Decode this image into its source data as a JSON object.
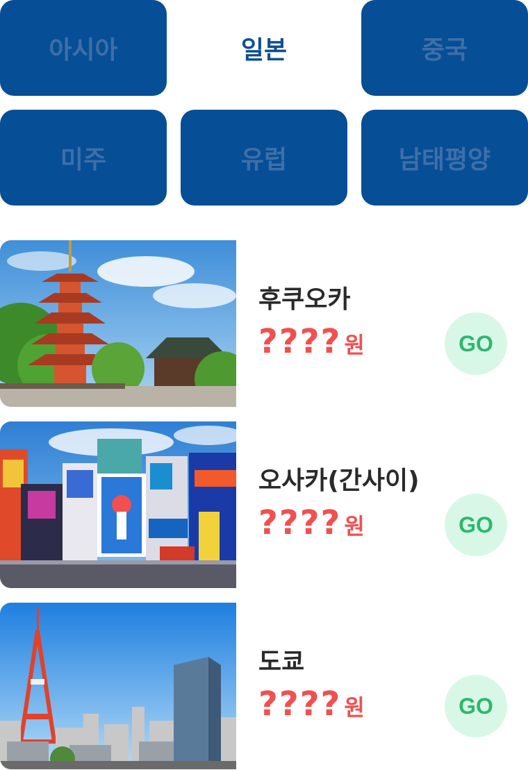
{
  "tabs": [
    {
      "label": "아시아"
    },
    {
      "label": "일본"
    },
    {
      "label": "중국"
    },
    {
      "label": "미주"
    },
    {
      "label": "유럽"
    },
    {
      "label": "남태평양"
    }
  ],
  "colors": {
    "tab_bg": "#064e96",
    "tab_text": "#3f6fa8",
    "active_text": "#0f4f93",
    "price": "#f24f4f",
    "go_bg": "#d9f7e6",
    "go_text": "#2cb86e"
  },
  "destinations": [
    {
      "city": "후쿠오카",
      "price": "????",
      "unit": "원",
      "go": "GO",
      "image": "pagoda-temple-photo"
    },
    {
      "city": "오사카(간사이)",
      "price": "????",
      "unit": "원",
      "go": "GO",
      "image": "dotonbori-billboards-photo"
    },
    {
      "city": "도쿄",
      "price": "????",
      "unit": "원",
      "go": "GO",
      "image": "tokyo-tower-skyline-photo"
    }
  ]
}
